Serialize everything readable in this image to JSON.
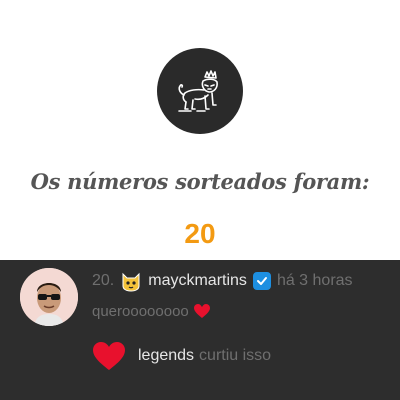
{
  "result": {
    "headline": "Os números sorteados foram:",
    "number": "20"
  },
  "comment": {
    "rank": "20.",
    "username": "mayckmartins",
    "time": "há 3 horas",
    "text": "queroooooooo",
    "liker": "legends",
    "liked_text": "curtiu isso"
  },
  "colors": {
    "accent": "#f39a12",
    "heart": "#e8112d",
    "verified": "#1d8fe1",
    "panel": "#2d2d2d"
  },
  "icons": {
    "logo": "lion-icon",
    "user_badge": "cat-face-icon",
    "verified": "check-badge-icon",
    "like": "heart-icon"
  }
}
